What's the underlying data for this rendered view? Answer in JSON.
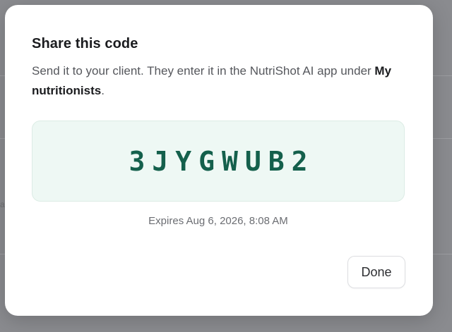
{
  "dialog": {
    "title": "Share this code",
    "description_prefix": "Send it to your client. They enter it in the NutriShot AI app under ",
    "description_emphasis": "My nutritionists",
    "description_suffix": ".",
    "code": "3JYGWUB2",
    "expires": "Expires Aug 6, 2026, 8:08 AM",
    "done_label": "Done"
  },
  "background": {
    "edge_char": "a"
  },
  "colors": {
    "overlay": "#8a8b8f",
    "code_bg": "#eef8f4",
    "code_text": "#14604c"
  }
}
